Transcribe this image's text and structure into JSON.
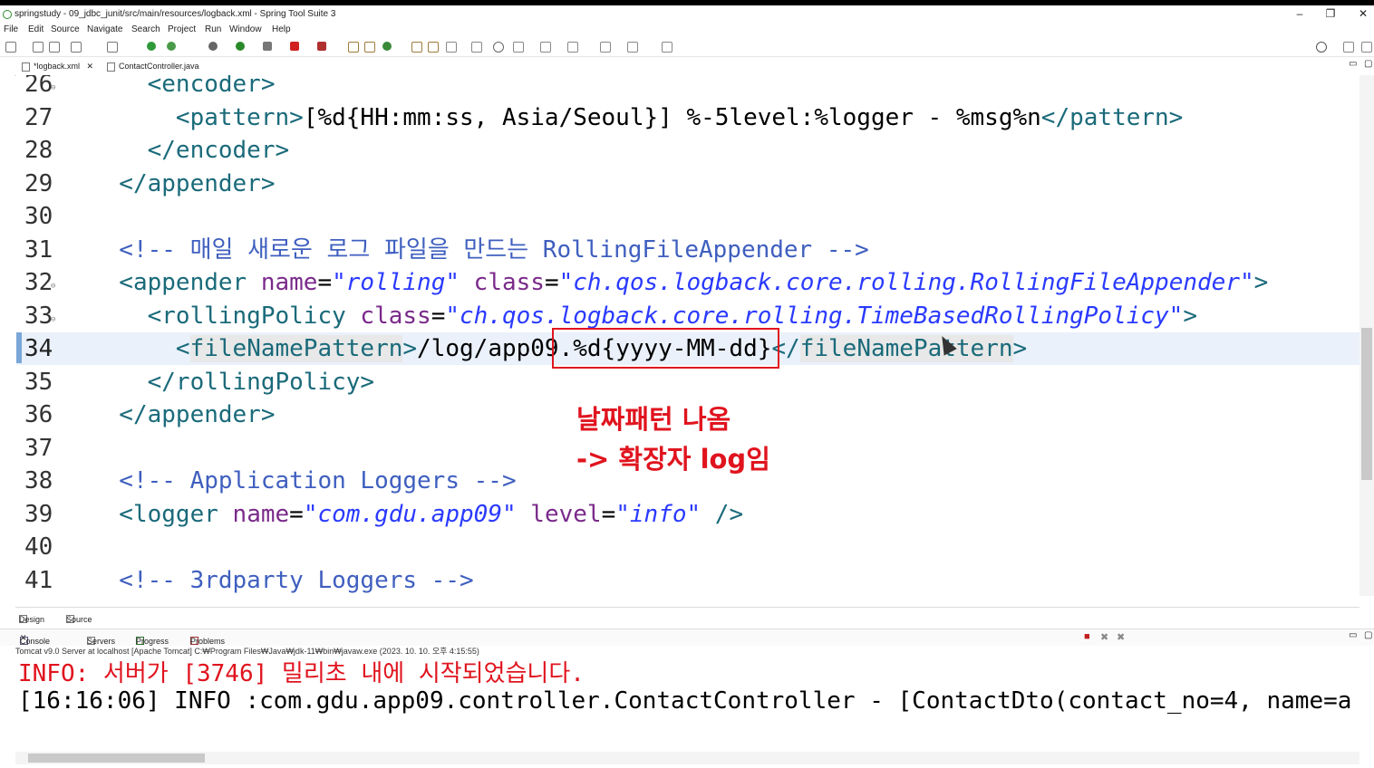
{
  "window": {
    "title": "springstudy - 09_jdbc_junit/src/main/resources/logback.xml - Spring Tool Suite 3",
    "minimize": "–",
    "maximize": "❐",
    "close": "✕"
  },
  "menu": [
    "File",
    "Edit",
    "Source",
    "Navigate",
    "Search",
    "Project",
    "Run",
    "Window",
    "Help"
  ],
  "tabs": [
    {
      "label": "*logback.xml",
      "icon": "xml-file-icon",
      "close": "✕"
    },
    {
      "label": "ContactController.java",
      "icon": "java-file-icon"
    }
  ],
  "editor": {
    "lines": [
      {
        "num": "26",
        "fold": "⊖",
        "code": [
          {
            "c": "tag",
            "t": "    <encoder>"
          }
        ]
      },
      {
        "num": "27",
        "code": [
          {
            "c": "tag",
            "t": "      <pattern>"
          },
          {
            "c": "tx",
            "t": "[%d{HH:mm:ss, Asia/Seoul}] %-5level:%logger - %msg%n"
          },
          {
            "c": "tag",
            "t": "</pattern>"
          }
        ]
      },
      {
        "num": "28",
        "code": [
          {
            "c": "tag",
            "t": "    </encoder>"
          }
        ]
      },
      {
        "num": "29",
        "code": [
          {
            "c": "tag",
            "t": "  </appender>"
          }
        ]
      },
      {
        "num": "30",
        "code": []
      },
      {
        "num": "31",
        "code": [
          {
            "c": "cm",
            "t": "  <!-- 매일 새로운 로그 파일을 만드는 RollingFileAppender -->"
          }
        ]
      },
      {
        "num": "32",
        "fold": "⊖",
        "code": [
          {
            "c": "tag",
            "t": "  <appender "
          },
          {
            "c": "an",
            "t": "name"
          },
          {
            "c": "tx",
            "t": "="
          },
          {
            "c": "av",
            "t": "\"rolling\""
          },
          {
            "c": "tx",
            "t": " "
          },
          {
            "c": "an",
            "t": "class"
          },
          {
            "c": "tx",
            "t": "="
          },
          {
            "c": "av",
            "t": "\"ch.qos.logback.core.rolling.RollingFileAppender\""
          },
          {
            "c": "tag",
            "t": ">"
          }
        ]
      },
      {
        "num": "33",
        "fold": "⊖",
        "code": [
          {
            "c": "tag",
            "t": "    <rollingPolicy "
          },
          {
            "c": "an",
            "t": "class"
          },
          {
            "c": "tx",
            "t": "="
          },
          {
            "c": "av",
            "t": "\"ch.qos.logback.core.rolling.TimeBasedRollingPolicy\""
          },
          {
            "c": "tag",
            "t": ">"
          }
        ]
      },
      {
        "num": "34",
        "current": true,
        "code": [
          {
            "c": "tag",
            "t": "      <"
          },
          {
            "c": "tag hl",
            "t": "fileNamePattern"
          },
          {
            "c": "tag",
            "t": ">"
          },
          {
            "c": "tx",
            "t": "/log/app09.%d{yyyy-MM-dd}"
          },
          {
            "c": "tag",
            "t": "</"
          },
          {
            "c": "tag hl",
            "t": "fileNamePattern"
          },
          {
            "c": "tag",
            "t": ">"
          }
        ]
      },
      {
        "num": "35",
        "code": [
          {
            "c": "tag",
            "t": "    </rollingPolicy>"
          }
        ]
      },
      {
        "num": "36",
        "code": [
          {
            "c": "tag",
            "t": "  </appender>"
          }
        ]
      },
      {
        "num": "37",
        "code": []
      },
      {
        "num": "38",
        "code": [
          {
            "c": "cm",
            "t": "  <!-- Application Loggers -->"
          }
        ]
      },
      {
        "num": "39",
        "code": [
          {
            "c": "tag",
            "t": "  <logger "
          },
          {
            "c": "an",
            "t": "name"
          },
          {
            "c": "tx",
            "t": "="
          },
          {
            "c": "av",
            "t": "\"com.gdu.app09\""
          },
          {
            "c": "tx",
            "t": " "
          },
          {
            "c": "an",
            "t": "level"
          },
          {
            "c": "tx",
            "t": "="
          },
          {
            "c": "av",
            "t": "\"info\""
          },
          {
            "c": "tag",
            "t": " />"
          }
        ]
      },
      {
        "num": "40",
        "code": []
      },
      {
        "num": "41",
        "code": [
          {
            "c": "cm",
            "t": "  <!-- 3rdparty Loggers -->"
          }
        ]
      }
    ]
  },
  "annotation": {
    "line1": "날짜패턴 나옴",
    "line2": "-> 확장자 log임"
  },
  "editor_tabs": {
    "design": "Design",
    "source": "Source"
  },
  "views": {
    "console": "Console",
    "servers": "Servers",
    "progress": "Progress",
    "problems": "Problems"
  },
  "console": {
    "info": "Tomcat v9.0 Server at localhost [Apache Tomcat] C:₩Program Files₩Java₩jdk-11₩bin₩javaw.exe  (2023. 10. 10. 오후 4:15:55)",
    "line1": "INFO: 서버가 [3746] 밀리초 내에 시작되었습니다.",
    "line2": "[16:16:06] INFO :com.gdu.app09.controller.ContactController - [ContactDto(contact_no=4, name=a"
  },
  "colors": {
    "annotation": "#e0141e",
    "tag": "#1a6a7a",
    "attr_name": "#7a2a8a",
    "attr_value": "#2a3aff",
    "comment": "#3f5fbf"
  }
}
